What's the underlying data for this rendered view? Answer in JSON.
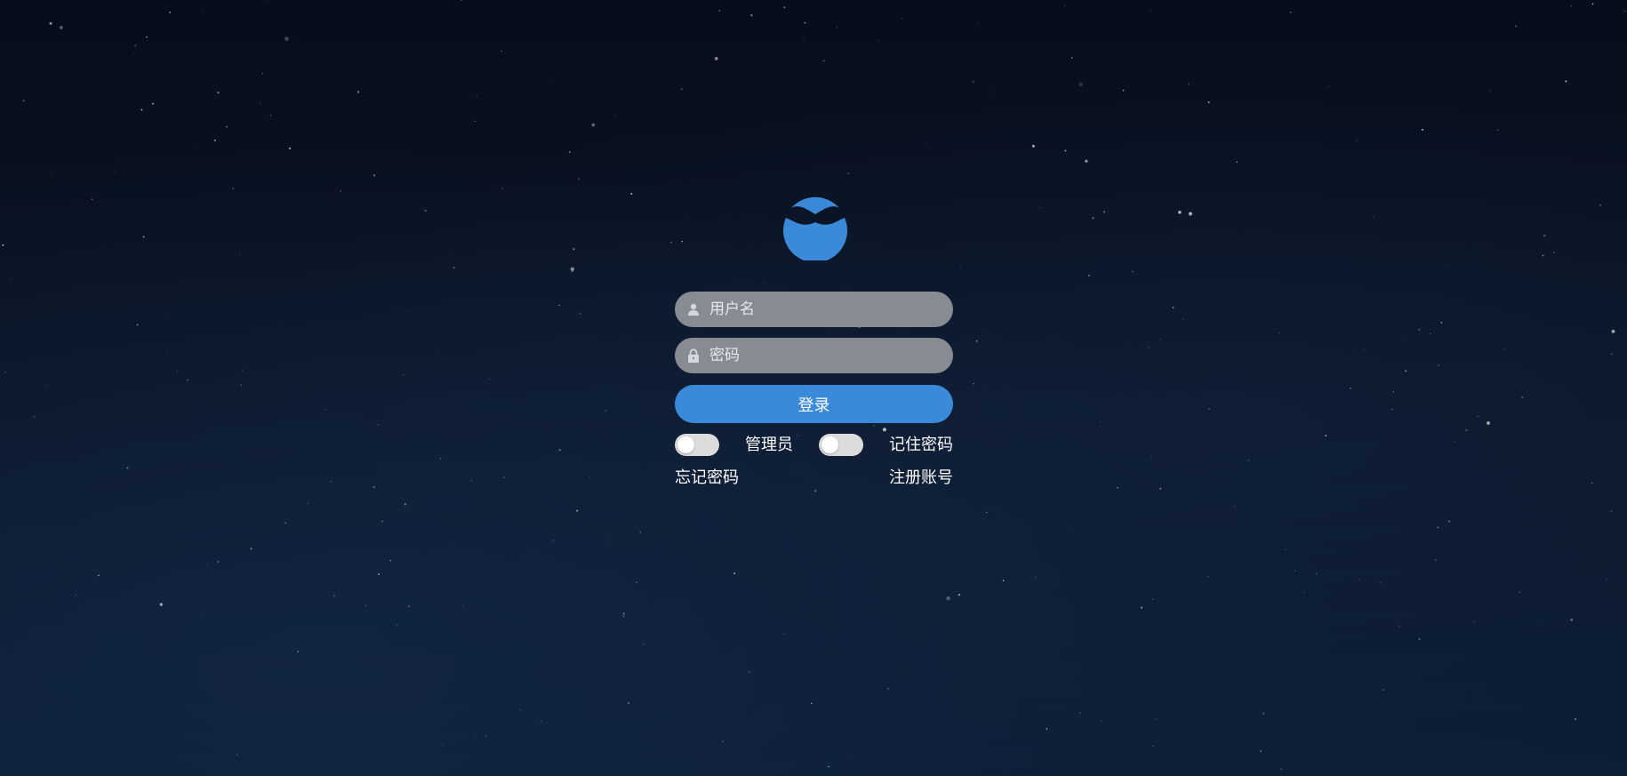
{
  "background": {
    "colors": [
      "#070d1a",
      "#0b1628",
      "#0d1e35"
    ]
  },
  "logo": {
    "icon": "wave-drop-logo",
    "color": "#3a8ad9"
  },
  "form": {
    "username": {
      "placeholder": "用户名",
      "value": "",
      "icon": "user-icon"
    },
    "password": {
      "placeholder": "密码",
      "value": "",
      "icon": "lock-icon"
    },
    "login_label": "登录",
    "accent": "#3a8ad9",
    "admin_toggle": {
      "label": "管理员",
      "checked": false
    },
    "remember_toggle": {
      "label": "记住密码",
      "checked": false
    },
    "forgot_password": "忘记密码",
    "register": "注册账号"
  }
}
